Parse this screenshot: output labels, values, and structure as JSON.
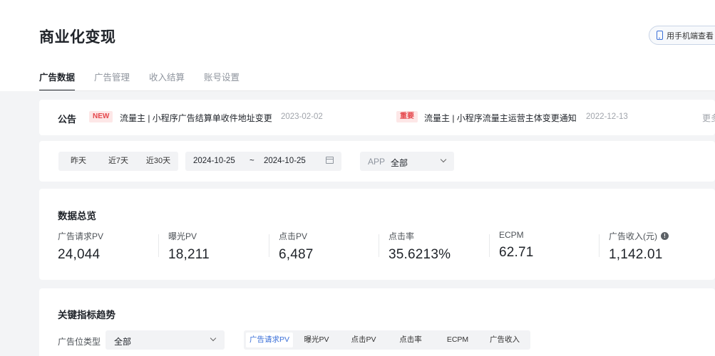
{
  "header": {
    "title": "商业化变现",
    "mobile_button_label": "用手机端查看"
  },
  "tabs": [
    {
      "label": "广告数据",
      "active": true
    },
    {
      "label": "广告管理",
      "active": false
    },
    {
      "label": "收入结算",
      "active": false
    },
    {
      "label": "账号设置",
      "active": false
    }
  ],
  "announcement": {
    "label": "公告",
    "items": [
      {
        "badge": "NEW",
        "text": "流量主 | 小程序广告结算单收件地址变更",
        "date": "2023-02-02"
      },
      {
        "badge": "重要",
        "text": "流量主 | 小程序流量主运营主体变更通知",
        "date": "2022-12-13"
      }
    ],
    "more_label": "更多"
  },
  "filters": {
    "quick_ranges": [
      "昨天",
      "近7天",
      "近30天"
    ],
    "date_start": "2024-10-25",
    "date_separator": "~",
    "date_end": "2024-10-25",
    "app_label": "APP",
    "app_value": "全部"
  },
  "overview": {
    "title": "数据总览",
    "metrics": [
      {
        "label": "广告请求PV",
        "value": "24,044"
      },
      {
        "label": "曝光PV",
        "value": "18,211"
      },
      {
        "label": "点击PV",
        "value": "6,487"
      },
      {
        "label": "点击率",
        "value": "35.6213%"
      },
      {
        "label": "ECPM",
        "value": "62.71"
      },
      {
        "label": "广告收入(元)",
        "value": "1,142.01",
        "info_icon": "info-circle-icon"
      }
    ]
  },
  "trend": {
    "title": "关键指标趋势",
    "ad_type_label": "广告位类型",
    "ad_type_value": "全部",
    "metric_tabs": [
      "广告请求PV",
      "曝光PV",
      "点击PV",
      "点击率",
      "ECPM",
      "广告收入"
    ],
    "active_metric_tab": "广告请求PV"
  },
  "colors": {
    "accent": "#3a6fd8",
    "badge_bg": "#fde7e7",
    "badge_text": "#e5484d",
    "page_bg": "#f3f4f6"
  }
}
